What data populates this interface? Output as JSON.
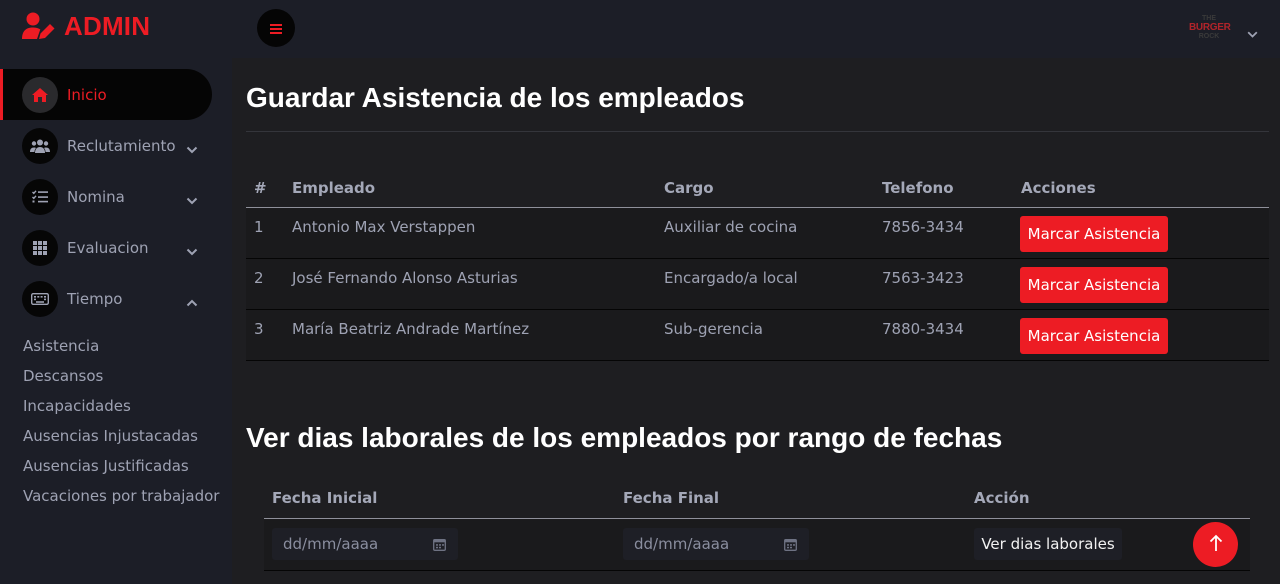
{
  "brand": {
    "title": "ADMIN",
    "icon": "user-pen-icon"
  },
  "sidebar": {
    "items": [
      {
        "label": "Inicio",
        "icon": "home-icon",
        "active": true
      },
      {
        "label": "Reclutamiento",
        "icon": "users-icon",
        "expanded": false
      },
      {
        "label": "Nomina",
        "icon": "list-check-icon",
        "expanded": false
      },
      {
        "label": "Evaluacion",
        "icon": "grid-icon",
        "expanded": false
      },
      {
        "label": "Tiempo",
        "icon": "keyboard-icon",
        "expanded": true
      }
    ],
    "submenu": [
      "Asistencia",
      "Descansos",
      "Incapacidades",
      "Ausencias Injustacadas",
      "Ausencias Justificadas",
      "Vacaciones por trabajador"
    ]
  },
  "topbar": {
    "logo": {
      "line1": "THE",
      "line2": "BURGER",
      "line3": "ROCK"
    }
  },
  "attendance": {
    "title": "Guardar Asistencia de los empleados",
    "columns": [
      "#",
      "Empleado",
      "Cargo",
      "Telefono",
      "Acciones"
    ],
    "rows": [
      {
        "num": "1",
        "name": "Antonio Max Verstappen",
        "role": "Auxiliar de cocina",
        "phone": "7856-3434",
        "action": "Marcar Asistencia"
      },
      {
        "num": "2",
        "name": "José Fernando Alonso Asturias",
        "role": "Encargado/a local",
        "phone": "7563-3423",
        "action": "Marcar Asistencia"
      },
      {
        "num": "3",
        "name": "María Beatriz Andrade Martínez",
        "role": "Sub-gerencia",
        "phone": "7880-3434",
        "action": "Marcar Asistencia"
      }
    ]
  },
  "workdays": {
    "title": "Ver dias laborales de los empleados por rango de fechas",
    "columns": [
      "Fecha Inicial",
      "Fecha Final",
      "Acción"
    ],
    "start_placeholder": "dd/mm/aaaa",
    "end_placeholder": "dd/mm/aaaa",
    "button": "Ver dias laborales"
  },
  "colors": {
    "accent": "#ed1c24",
    "sidebar": "#1c1e27",
    "background": "#1e1e21"
  }
}
